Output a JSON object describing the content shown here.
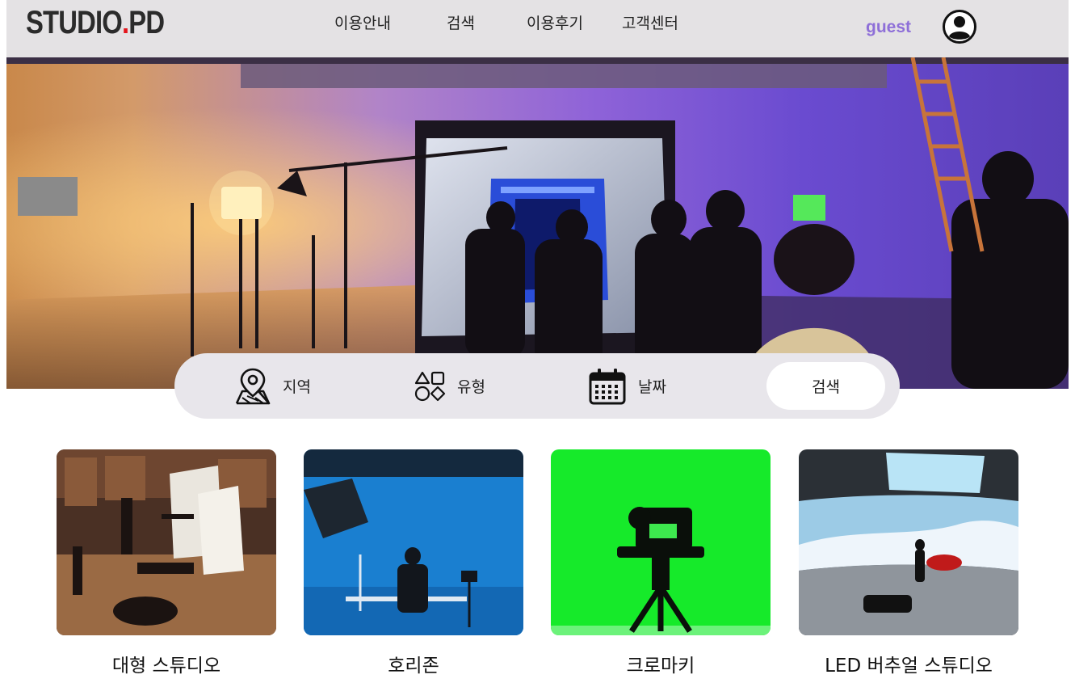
{
  "header": {
    "logo_main": "STUDIO",
    "logo_dot": ".",
    "logo_suffix": "PD",
    "nav": [
      "이용안내",
      "검색",
      "이용후기",
      "고객센터"
    ],
    "user_name": "guest"
  },
  "search": {
    "region_label": "지역",
    "type_label": "유형",
    "date_label": "날짜",
    "search_button": "검색"
  },
  "categories": [
    {
      "title": "대형 스튜디오"
    },
    {
      "title": "호리존"
    },
    {
      "title": "크로마키"
    },
    {
      "title": "LED 버추얼 스튜디오"
    }
  ]
}
